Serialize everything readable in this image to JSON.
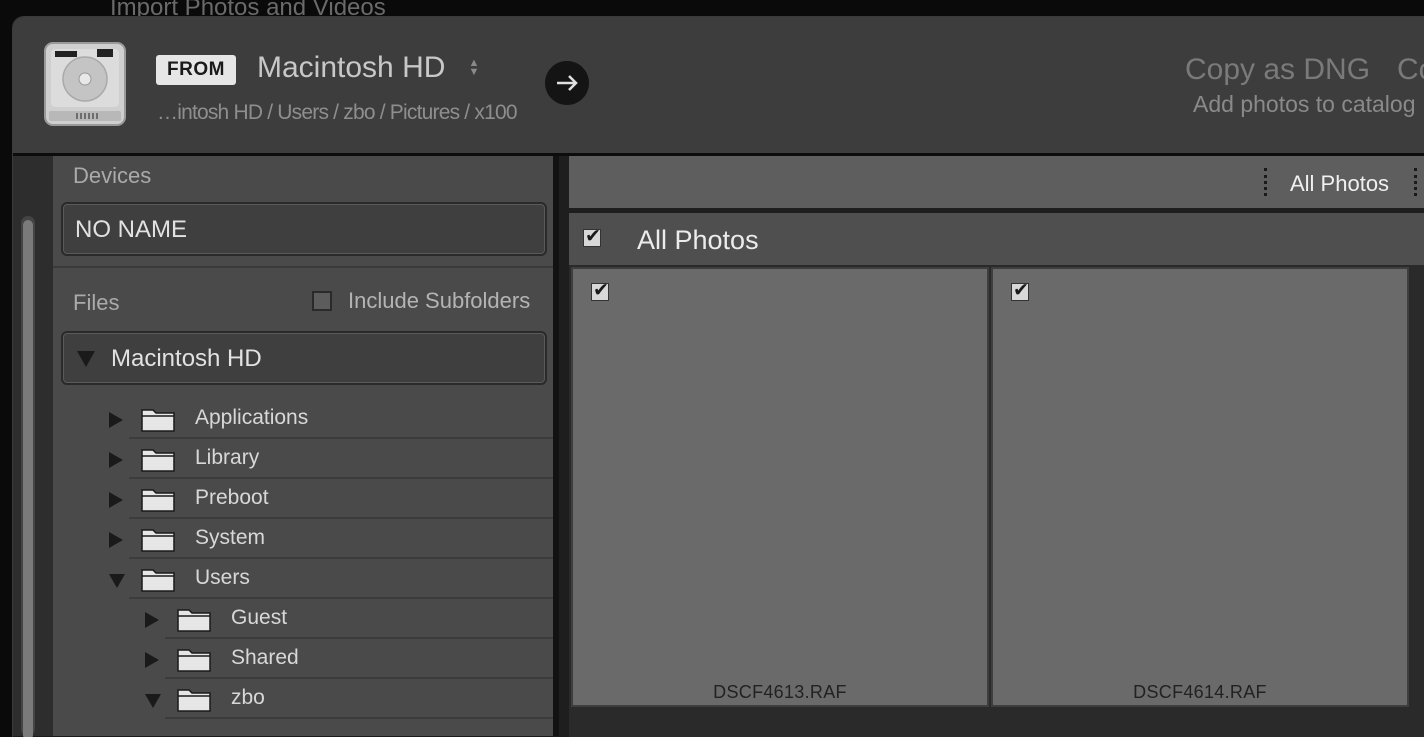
{
  "window": {
    "behind_title": "Import Photos and Videos"
  },
  "source": {
    "from_label": "FROM",
    "name": "Macintosh HD",
    "path": "…intosh HD / Users / zbo / Pictures / x100"
  },
  "mode": {
    "copy_as_dng": "Copy as DNG",
    "copy": "Co",
    "description": "Add photos to catalog"
  },
  "sidebar": {
    "devices_label": "Devices",
    "device_name": "NO NAME",
    "files_label": "Files",
    "include_subfolders": "Include Subfolders",
    "volume_name": "Macintosh HD",
    "tree": [
      {
        "label": "Applications",
        "expanded": false,
        "depth": 0
      },
      {
        "label": "Library",
        "expanded": false,
        "depth": 0
      },
      {
        "label": "Preboot",
        "expanded": false,
        "depth": 0
      },
      {
        "label": "System",
        "expanded": false,
        "depth": 0
      },
      {
        "label": "Users",
        "expanded": true,
        "depth": 0
      },
      {
        "label": "Guest",
        "expanded": false,
        "depth": 1
      },
      {
        "label": "Shared",
        "expanded": false,
        "depth": 1
      },
      {
        "label": "zbo",
        "expanded": true,
        "depth": 1
      }
    ]
  },
  "grid": {
    "view_filter": "All Photos",
    "header_title": "All Photos",
    "photos": [
      {
        "filename": "DSCF4613.RAF",
        "checked": true
      },
      {
        "filename": "DSCF4614.RAF",
        "checked": true
      }
    ]
  },
  "colors": {
    "header_bg": "#3d3d3d",
    "panel_bg": "#4a4a4a",
    "thumb_bg": "#6a6a6a",
    "badge_bg": "#e6e6e6"
  }
}
